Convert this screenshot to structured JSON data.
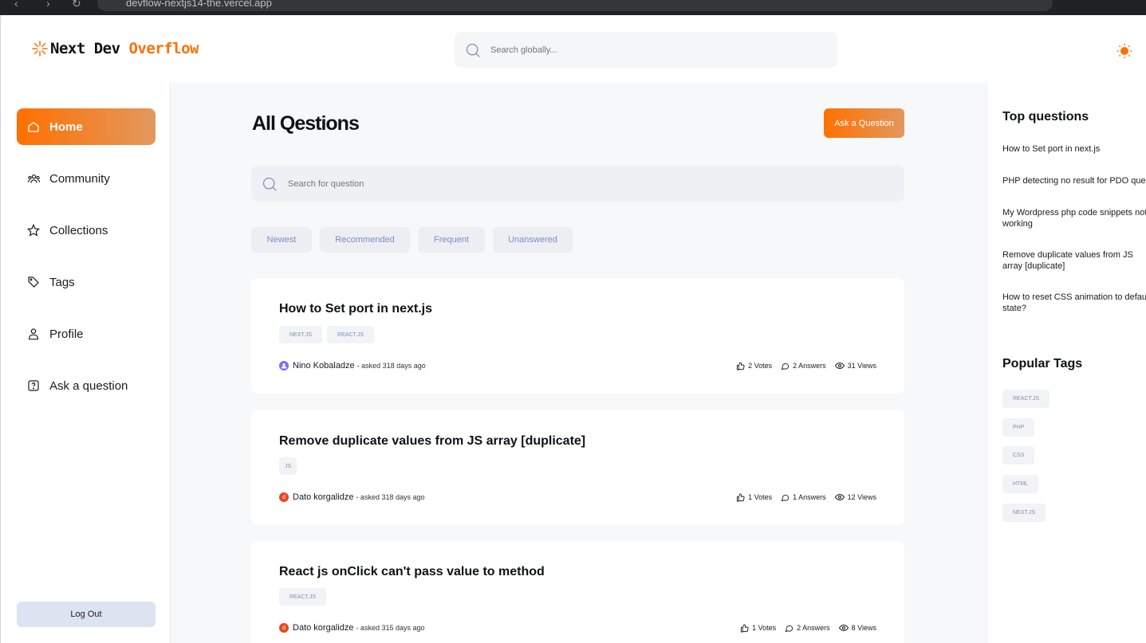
{
  "browser": {
    "url": "devflow-nextjs14-the.vercel.app"
  },
  "brand": {
    "name_part1": "Next Dev",
    "name_part2": "Overflow",
    "accent_color": "#ff7000"
  },
  "navbar": {
    "search_placeholder": "Search globally...",
    "theme_icon": "sun-icon"
  },
  "sidebar": {
    "items": [
      {
        "label": "Home",
        "icon": "home-icon",
        "active": true
      },
      {
        "label": "Community",
        "icon": "users-icon"
      },
      {
        "label": "Collections",
        "icon": "star-icon"
      },
      {
        "label": "Tags",
        "icon": "tag-icon"
      },
      {
        "label": "Profile",
        "icon": "user-icon"
      },
      {
        "label": "Ask a question",
        "icon": "question-icon"
      }
    ],
    "logout_label": "Log Out"
  },
  "main": {
    "title": "All Qestions",
    "ask_button": "Ask a Question",
    "search_placeholder": "Search for question",
    "filters": [
      "Newest",
      "Recommended",
      "Frequent",
      "Unanswered"
    ],
    "questions": [
      {
        "title": "How to Set port in next.js",
        "tags": [
          "NEXT.JS",
          "REACT.JS"
        ],
        "author": "Nino Kobaladze",
        "asked": "- asked 318 days ago",
        "votes": "2 Votes",
        "answers": "2 Answers",
        "views": "31 Views"
      },
      {
        "title": "Remove duplicate values from JS array [duplicate]",
        "tags": [
          "JS"
        ],
        "author": "Dato korgalidze",
        "asked": "- asked 318 days ago",
        "votes": "1 Votes",
        "answers": "1 Answers",
        "views": "12 Views"
      },
      {
        "title": "React js onClick can't pass value to method",
        "tags": [
          "REACT.JS"
        ],
        "author": "Dato korgalidze",
        "asked": "- asked 315 days ago",
        "votes": "1 Votes",
        "answers": "2 Answers",
        "views": "8 Views"
      }
    ]
  },
  "rightbar": {
    "top_heading": "Top questions",
    "top_questions": [
      "How to Set port in next.js",
      "PHP detecting no result for PDO query",
      "My Wordpress php code snippets not working",
      "Remove duplicate values from JS array [duplicate]",
      "How to reset CSS animation to default state?"
    ],
    "tags_heading": "Popular Tags",
    "popular_tags": [
      "REACT.JS",
      "PHP",
      "CSS",
      "HTML",
      "NEXT.JS"
    ]
  }
}
